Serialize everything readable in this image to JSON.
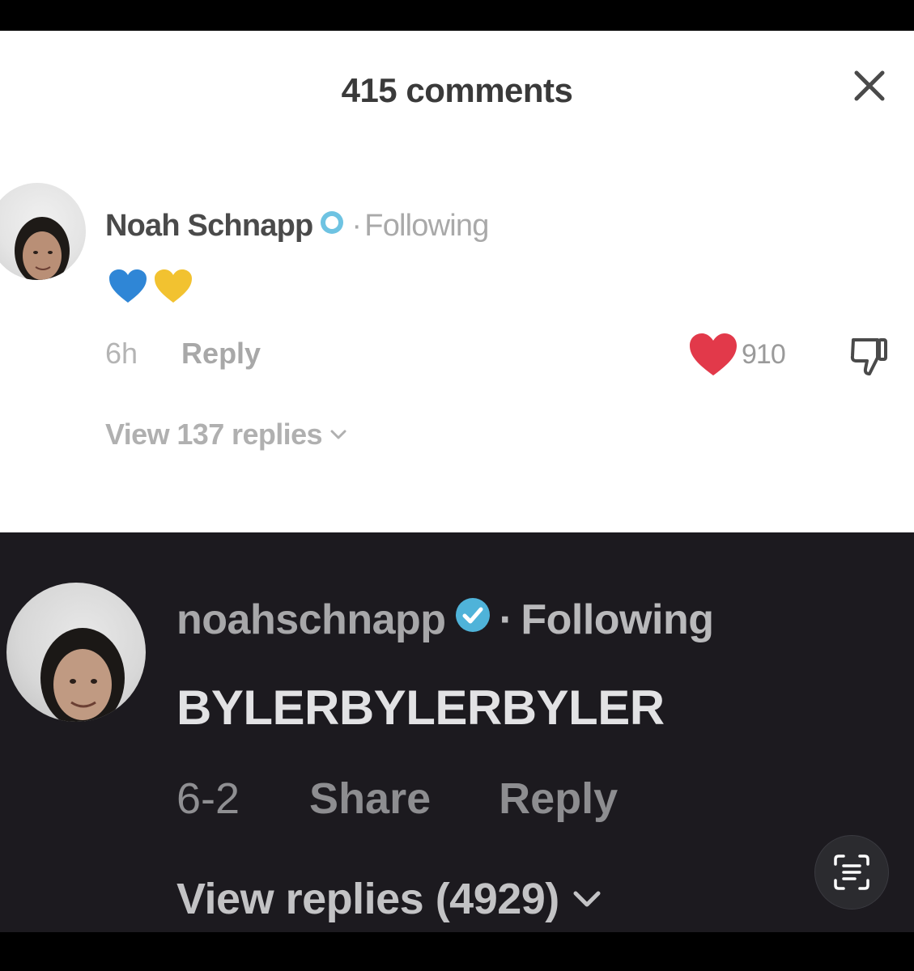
{
  "header": {
    "comment_count": "415 comments",
    "close_icon": "close-icon"
  },
  "comment_light": {
    "author": "Noah Schnapp",
    "separator": "·",
    "following": "Following",
    "hearts": [
      {
        "icon": "blue-heart-icon",
        "color": "#2f86d6"
      },
      {
        "icon": "yellow-heart-icon",
        "color": "#f2c230"
      }
    ],
    "time": "6h",
    "reply_label": "Reply",
    "likes": "910",
    "like_color": "#e2394a",
    "view_replies": "View 137 replies"
  },
  "comment_dark": {
    "author": "noahschnapp",
    "separator": "·",
    "following": "Following",
    "text": "BYLERBYLERBYLER",
    "date": "6-2",
    "share_label": "Share",
    "reply_label": "Reply",
    "view_replies": "View replies (4929)"
  },
  "colors": {
    "verified": "#4fb3d9",
    "dark_background": "#1c1a1f"
  },
  "overlay": {
    "scan_icon": "live-text-scan-icon"
  }
}
